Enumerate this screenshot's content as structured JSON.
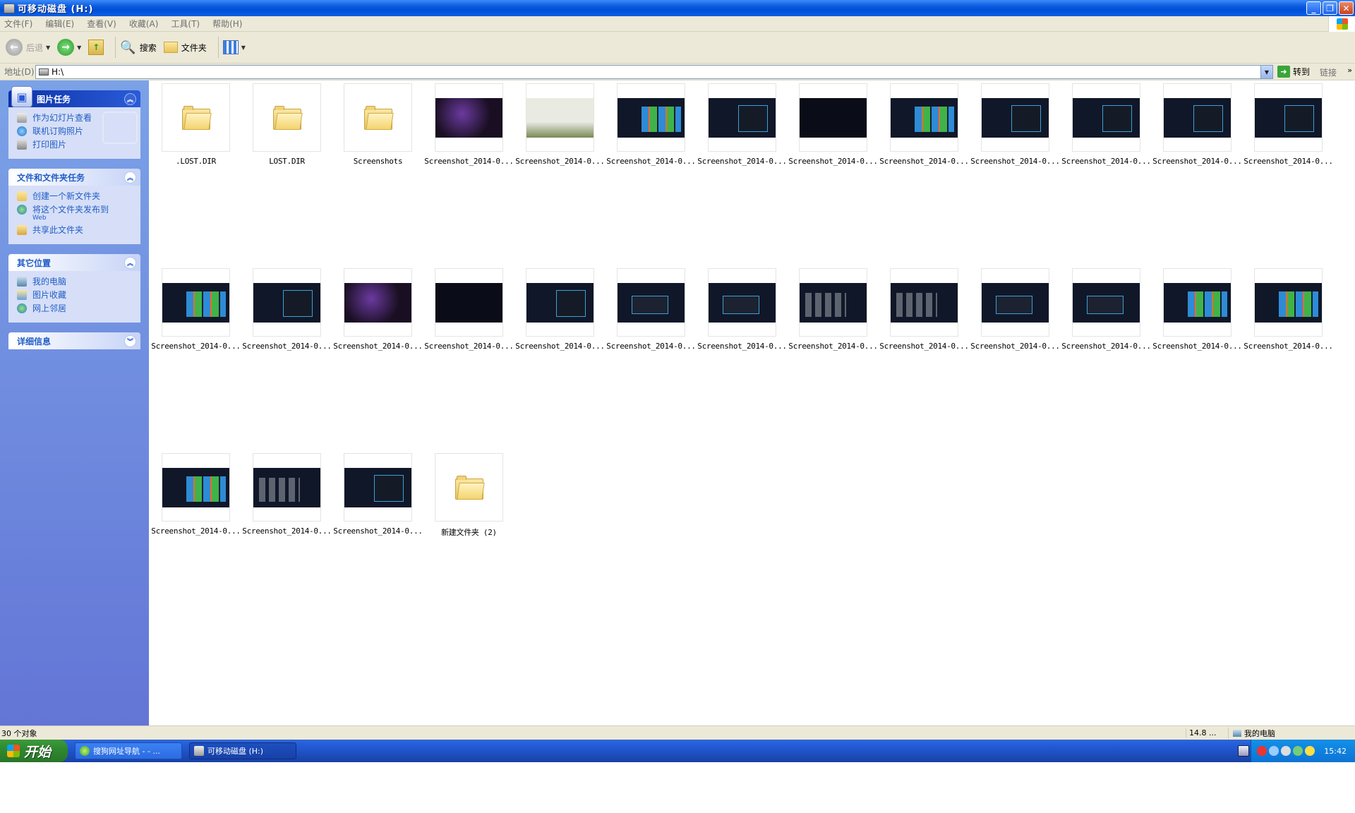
{
  "window": {
    "title": "可移动磁盘 (H:)"
  },
  "menu": [
    "文件(F)",
    "编辑(E)",
    "查看(V)",
    "收藏(A)",
    "工具(T)",
    "帮助(H)"
  ],
  "toolbar": {
    "back": "后退",
    "search": "搜索",
    "folders": "文件夹"
  },
  "address": {
    "label": "地址(D)",
    "value": "H:\\",
    "go": "转到",
    "links": "链接",
    "more": "»"
  },
  "sidebar": {
    "picture_tasks": {
      "title": "图片任务",
      "items": [
        {
          "label": "作为幻灯片查看",
          "icon": "slideshow-icon"
        },
        {
          "label": "联机订购照片",
          "icon": "order-photos-icon"
        },
        {
          "label": "打印图片",
          "icon": "printer-icon"
        }
      ]
    },
    "file_tasks": {
      "title": "文件和文件夹任务",
      "items": [
        {
          "label": "创建一个新文件夹",
          "sub": "",
          "icon": "new-folder-icon"
        },
        {
          "label": "将这个文件夹发布到",
          "sub": "Web",
          "icon": "web-publish-icon"
        },
        {
          "label": "共享此文件夹",
          "sub": "",
          "icon": "share-folder-icon"
        }
      ]
    },
    "other_places": {
      "title": "其它位置",
      "items": [
        {
          "label": "我的电脑",
          "icon": "my-computer-icon"
        },
        {
          "label": "图片收藏",
          "icon": "my-pictures-icon"
        },
        {
          "label": "网上邻居",
          "icon": "network-icon"
        }
      ]
    },
    "details": {
      "title": "详细信息"
    }
  },
  "files": [
    {
      "name": ".LOST.DIR",
      "kind": "folder"
    },
    {
      "name": "LOST.DIR",
      "kind": "folder"
    },
    {
      "name": "Screenshots",
      "kind": "folder"
    },
    {
      "name": "Screenshot_2014-0...",
      "kind": "image",
      "look": "stage"
    },
    {
      "name": "Screenshot_2014-0...",
      "kind": "image",
      "look": "photo"
    },
    {
      "name": "Screenshot_2014-0...",
      "kind": "image",
      "look": "tiles"
    },
    {
      "name": "Screenshot_2014-0...",
      "kind": "image",
      "look": "panel"
    },
    {
      "name": "Screenshot_2014-0...",
      "kind": "image",
      "look": "dark"
    },
    {
      "name": "Screenshot_2014-0...",
      "kind": "image",
      "look": "tiles"
    },
    {
      "name": "Screenshot_2014-0...",
      "kind": "image",
      "look": "panel"
    },
    {
      "name": "Screenshot_2014-0...",
      "kind": "image",
      "look": "panel"
    },
    {
      "name": "Screenshot_2014-0...",
      "kind": "image",
      "look": "panel"
    },
    {
      "name": "Screenshot_2014-0...",
      "kind": "image",
      "look": "panel"
    },
    {
      "name": "Screenshot_2014-0...",
      "kind": "image",
      "look": "tiles"
    },
    {
      "name": "Screenshot_2014-0...",
      "kind": "image",
      "look": "panel"
    },
    {
      "name": "Screenshot_2014-0...",
      "kind": "image",
      "look": "stage"
    },
    {
      "name": "Screenshot_2014-0...",
      "kind": "image",
      "look": "dark"
    },
    {
      "name": "Screenshot_2014-0...",
      "kind": "image",
      "look": "panel"
    },
    {
      "name": "Screenshot_2014-0...",
      "kind": "image",
      "look": "dialog"
    },
    {
      "name": "Screenshot_2014-0...",
      "kind": "image",
      "look": "dialog"
    },
    {
      "name": "Screenshot_2014-0...",
      "kind": "image",
      "look": "grid"
    },
    {
      "name": "Screenshot_2014-0...",
      "kind": "image",
      "look": "grid"
    },
    {
      "name": "Screenshot_2014-0...",
      "kind": "image",
      "look": "dialog"
    },
    {
      "name": "Screenshot_2014-0...",
      "kind": "image",
      "look": "dialog"
    },
    {
      "name": "Screenshot_2014-0...",
      "kind": "image",
      "look": "tiles"
    },
    {
      "name": "Screenshot_2014-0...",
      "kind": "image",
      "look": "tiles"
    },
    {
      "name": "Screenshot_2014-0...",
      "kind": "image",
      "look": "tiles"
    },
    {
      "name": "Screenshot_2014-0...",
      "kind": "image",
      "look": "grid"
    },
    {
      "name": "Screenshot_2014-0...",
      "kind": "image",
      "look": "panel"
    },
    {
      "name": "新建文件夹 (2)",
      "kind": "folder"
    }
  ],
  "status": {
    "count": "30 个对象",
    "size": "14.8 ...",
    "location": "我的电脑"
  },
  "taskbar": {
    "start": "开始",
    "tasks": [
      "搜狗网址导航 - - ...",
      "可移动磁盘 (H:)"
    ],
    "clock": "15:42"
  }
}
